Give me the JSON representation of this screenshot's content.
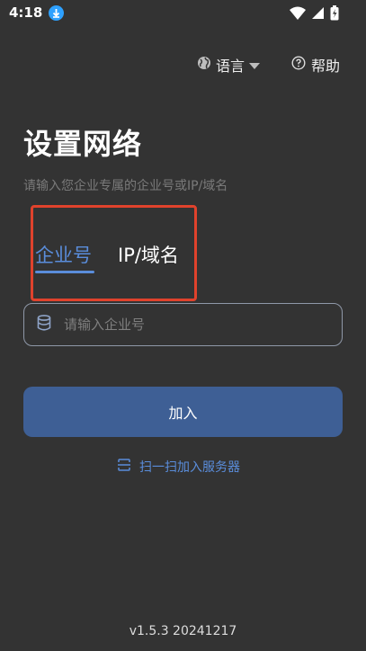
{
  "status_bar": {
    "time": "4:18",
    "icons": [
      "download-badge-icon",
      "wifi-icon",
      "signal-icon",
      "battery-icon"
    ]
  },
  "top_actions": {
    "language_label": "语言",
    "help_label": "帮助"
  },
  "header": {
    "title": "设置网络",
    "subtitle": "请输入您企业专属的企业号或IP/域名"
  },
  "tabs": [
    {
      "label": "企业号",
      "active": true
    },
    {
      "label": "IP/域名",
      "active": false
    }
  ],
  "form": {
    "enterprise_placeholder": "请输入企业号",
    "enterprise_value": ""
  },
  "actions": {
    "join_label": "加入",
    "scan_label": "扫一扫加入服务器"
  },
  "footer": {
    "version": "v1.5.3 20241217"
  },
  "colors": {
    "background": "#333333",
    "accent": "#5a8ddb",
    "button": "#3e5f95",
    "annotation": "#e0422c"
  }
}
